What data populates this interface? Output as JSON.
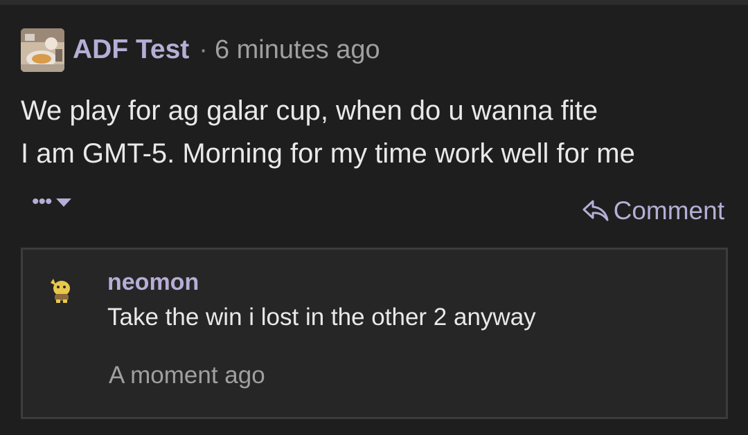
{
  "post": {
    "author": "ADF Test",
    "separator": "·",
    "time": "6 minutes ago",
    "lines": [
      "We play for ag galar cup, when do u wanna fite",
      "I am GMT-5. Morning for my time work well for me"
    ],
    "avatar_icon": "user-photo-avatar"
  },
  "actions": {
    "more_label": "•••",
    "more_icon": "caret-down-icon",
    "comment_label": "Comment",
    "comment_icon": "reply-arrow-icon"
  },
  "reply": {
    "author": "neomon",
    "text": "Take the win i lost in the other 2 anyway",
    "time": "A moment ago",
    "avatar_icon": "pokemon-sprite-avatar"
  },
  "colors": {
    "background": "#1e1e1e",
    "accent": "#b6aed6",
    "text": "#e9e9e9",
    "muted": "#a0a0a0",
    "reply_border": "#3c3c3c"
  }
}
